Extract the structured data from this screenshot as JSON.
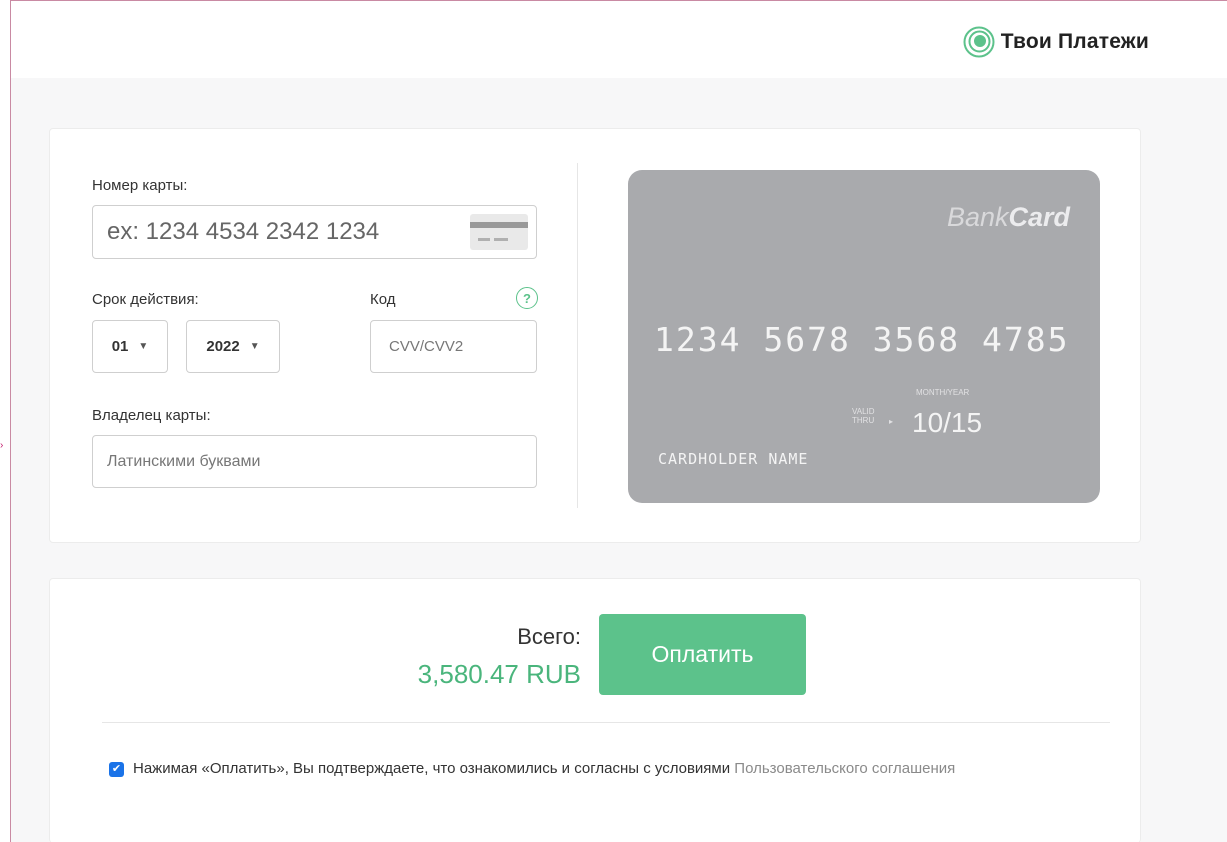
{
  "header": {
    "logo_text": "Твои Платежи",
    "logo_icon": "concentric-circles-icon"
  },
  "card_form": {
    "number_label": "Номер карты:",
    "number_placeholder": "ex: 1234 4534 2342 1234",
    "expiry_label": "Срок действия:",
    "month_value": "01",
    "year_value": "2022",
    "cvv_label": "Код",
    "cvv_placeholder": "CVV/CVV2",
    "help_symbol": "?",
    "holder_label": "Владелец карты:",
    "holder_placeholder": "Латинскими буквами"
  },
  "card_preview": {
    "brand_regular": "Bank",
    "brand_bold": "Card",
    "number": "1234 5678 3568 4785",
    "month_year_label": "MONTH/YEAR",
    "valid_line1": "VALID",
    "valid_line2": "THRU",
    "expiry": "10/15",
    "holder": "CARDHOLDER NAME"
  },
  "payment": {
    "total_label": "Всего:",
    "total_value": "3,580.47 RUB",
    "pay_button": "Оплатить",
    "consent_checked": true,
    "consent_text": "Нажимая «Оплатить», Вы подтверждаете, что ознакомились и согласны с условиями",
    "consent_link": "Пользовательского соглашения"
  },
  "colors": {
    "accent": "#5cc28b",
    "total_text": "#4ab57c",
    "card_bg": "#a9aaad",
    "checkbox": "#1a73e8"
  }
}
